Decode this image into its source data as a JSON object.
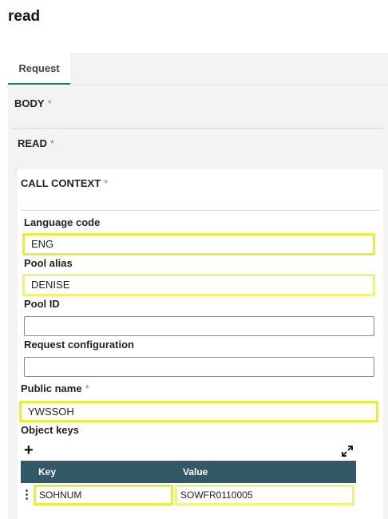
{
  "page": {
    "title": "read"
  },
  "tabs": [
    {
      "label": "Request"
    }
  ],
  "sections": {
    "body": "BODY",
    "read": "READ",
    "call_context": "CALL CONTEXT",
    "required_mark": "*"
  },
  "fields": {
    "language_code": {
      "label": "Language code",
      "value": "ENG"
    },
    "pool_alias": {
      "label": "Pool alias",
      "value": "DENISE"
    },
    "pool_id": {
      "label": "Pool ID",
      "value": ""
    },
    "request_configuration": {
      "label": "Request configuration",
      "value": ""
    },
    "public_name": {
      "label": "Public name",
      "value": "YWSSOH"
    }
  },
  "object_keys": {
    "label": "Object keys",
    "add_icon": "plus-icon",
    "expand_icon": "expand-icon",
    "columns": [
      "Key",
      "Value"
    ],
    "rows": [
      {
        "key": "SOHNUM",
        "value": "SOWFR0110005"
      }
    ]
  },
  "colors": {
    "accent": "#1e7b6a",
    "table_header": "#345966",
    "highlight": "#e8ec3a",
    "required": "#d26a4e"
  }
}
